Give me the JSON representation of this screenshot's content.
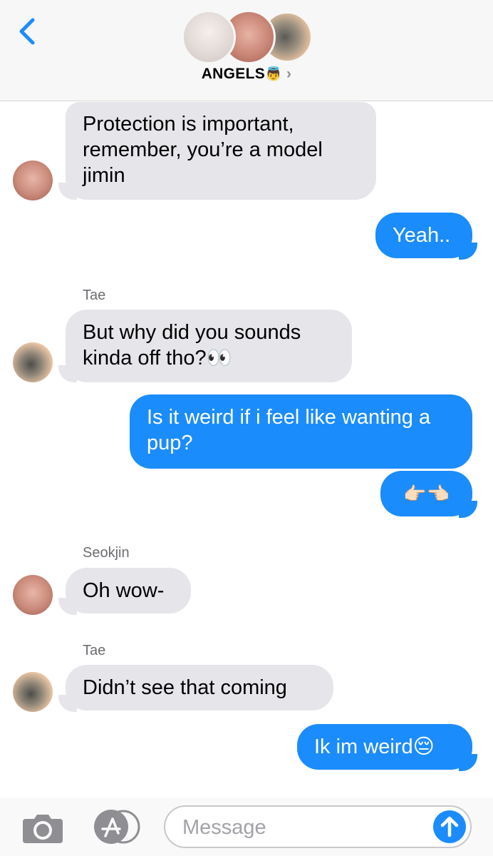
{
  "header": {
    "title": "ANGELS",
    "title_emoji": "👼",
    "chevron": "›",
    "back_icon": "chevron-left-icon",
    "group_avatars": [
      "avatar-jimin",
      "avatar-seokjin",
      "avatar-tae"
    ]
  },
  "messages": [
    {
      "sender": "",
      "direction": "in",
      "text": "Protection is important, remember, you’re a model jimin",
      "avatar": "seokjin"
    },
    {
      "sender": "",
      "direction": "out",
      "text": "Yeah.."
    },
    {
      "sender": "Tae",
      "direction": "in",
      "text": "But why did you sounds kinda off tho?👀",
      "avatar": "tae"
    },
    {
      "sender": "",
      "direction": "out",
      "text": "Is it weird if i feel like wanting a pup?"
    },
    {
      "sender": "",
      "direction": "out",
      "text": "👉🏻👈🏻"
    },
    {
      "sender": "Seokjin",
      "direction": "in",
      "text": "Oh wow-",
      "avatar": "seokjin"
    },
    {
      "sender": "Tae",
      "direction": "in",
      "text": "Didn’t see that coming",
      "avatar": "tae"
    },
    {
      "sender": "",
      "direction": "out",
      "text": "Ik im weird😔"
    }
  ],
  "composer": {
    "placeholder": "Message",
    "value": "",
    "camera_icon": "camera-icon",
    "apps_icon": "app-store-icon",
    "send_icon": "arrow-up-icon"
  },
  "colors": {
    "outgoing_bubble": "#1b8cfb",
    "incoming_bubble": "#e5e5ea",
    "header_bg": "#f7f7f7",
    "accent": "#1b8cfb"
  }
}
